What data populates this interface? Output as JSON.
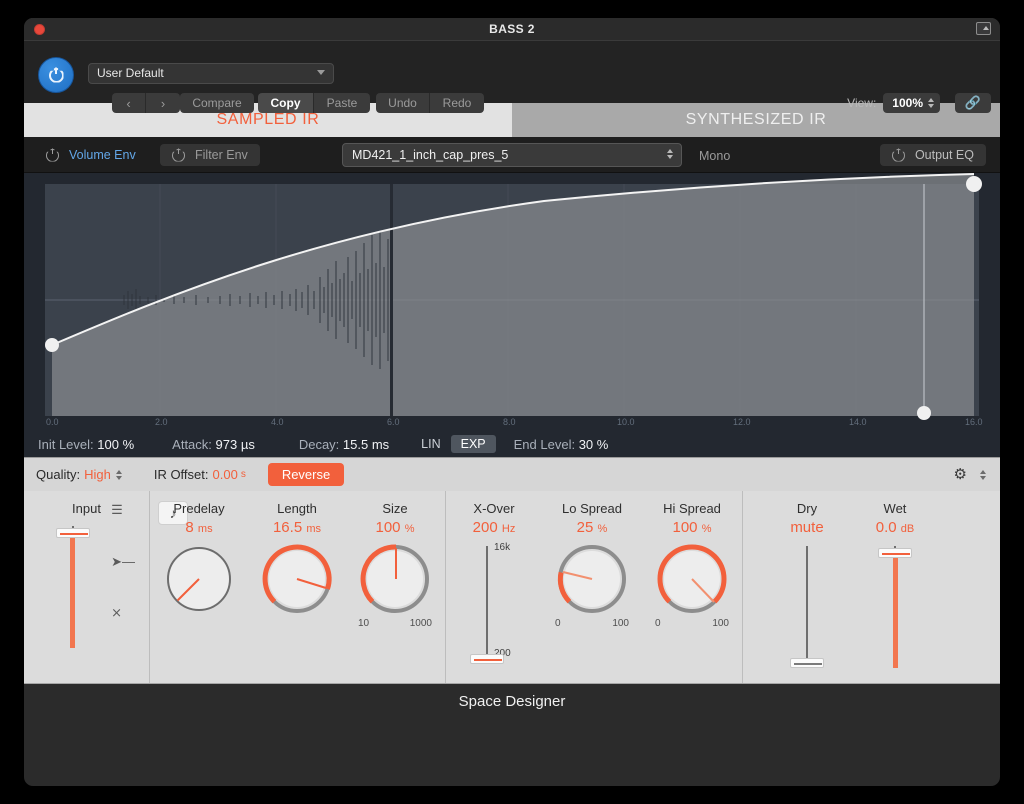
{
  "window": {
    "title": "BASS 2",
    "close_icon": "close-dot",
    "expand_icon": "expand-icon"
  },
  "toolbar": {
    "power_icon": "power-icon",
    "preset": "User Default",
    "prev_label": "‹",
    "next_label": "›",
    "compare_label": "Compare",
    "copy_label": "Copy",
    "paste_label": "Paste",
    "undo_label": "Undo",
    "redo_label": "Redo",
    "view_label": "View:",
    "view_value": "100%",
    "link_icon": "🔗"
  },
  "tabs": [
    {
      "label": "SAMPLED IR",
      "selected": true
    },
    {
      "label": "SYNTHESIZED IR",
      "selected": false
    }
  ],
  "envbar": {
    "volume_env": "Volume Env",
    "filter_env": "Filter Env",
    "ir_name": "MD421_1_inch_cap_pres_5",
    "mono": "Mono",
    "output_eq": "Output EQ"
  },
  "envelope": {
    "ruler_ticks": [
      "0.0",
      "2.0",
      "4.0",
      "6.0",
      "8.0",
      "10.0",
      "12.0",
      "14.0",
      "16.0"
    ],
    "init_level_label": "Init Level:",
    "init_level_value": "100 %",
    "attack_label": "Attack:",
    "attack_value": "973 µs",
    "decay_label": "Decay:",
    "decay_value": "15.5 ms",
    "lin_label": "LIN",
    "exp_label": "EXP",
    "curve_mode": "EXP",
    "end_level_label": "End Level:",
    "end_level_value": "30 %"
  },
  "qualitybar": {
    "quality_label": "Quality:",
    "quality_value": "High",
    "ir_offset_label": "IR Offset:",
    "ir_offset_value": "0.00",
    "ir_offset_unit": "s",
    "reverse_label": "Reverse",
    "gear_icon": "gear-icon"
  },
  "panel": {
    "input": {
      "name": "Input",
      "icons": [
        "stereo-icon",
        "merge-icon",
        "cross-icon"
      ],
      "handle_pct": 2,
      "fill_color": "#f2764f"
    },
    "note_icon": "note-icon",
    "knobs": [
      {
        "name": "Predelay",
        "value": "8",
        "unit": "ms",
        "arc_start": -135,
        "arc_end": -135,
        "pointer": 128,
        "range": null
      },
      {
        "name": "Length",
        "value": "16.5",
        "unit": "ms",
        "arc_start": -135,
        "arc_end": 62,
        "pointer": 72,
        "range": null
      },
      {
        "name": "Size",
        "value": "100",
        "unit": "%",
        "arc_start": -135,
        "arc_end": -3,
        "pointer": 0,
        "range": [
          "10",
          "1000"
        ]
      },
      {
        "name": "Lo Spread",
        "value": "25",
        "unit": "%",
        "arc_start": -135,
        "arc_end": -84,
        "pointer": -77,
        "range": [
          "0",
          "100"
        ]
      },
      {
        "name": "Hi Spread",
        "value": "100",
        "unit": "%",
        "arc_start": -135,
        "arc_end": 135,
        "pointer": 152,
        "range": [
          "0",
          "100"
        ]
      }
    ],
    "xover": {
      "name": "X-Over",
      "value": "200",
      "unit": "Hz",
      "top_label": "16k",
      "bottom_label": "200",
      "handle_pct": 100
    },
    "dry": {
      "name": "Dry",
      "value": "mute",
      "handle_pct": 100
    },
    "wet": {
      "name": "Wet",
      "value": "0.0",
      "unit": "dB",
      "handle_pct": 2
    }
  },
  "footer": {
    "plugin_name": "Space Designer"
  },
  "colors": {
    "accent": "#f2603c",
    "active_blue": "#63a7e8",
    "panel_bg": "#dcdcdc",
    "display_bg": "#232830"
  }
}
